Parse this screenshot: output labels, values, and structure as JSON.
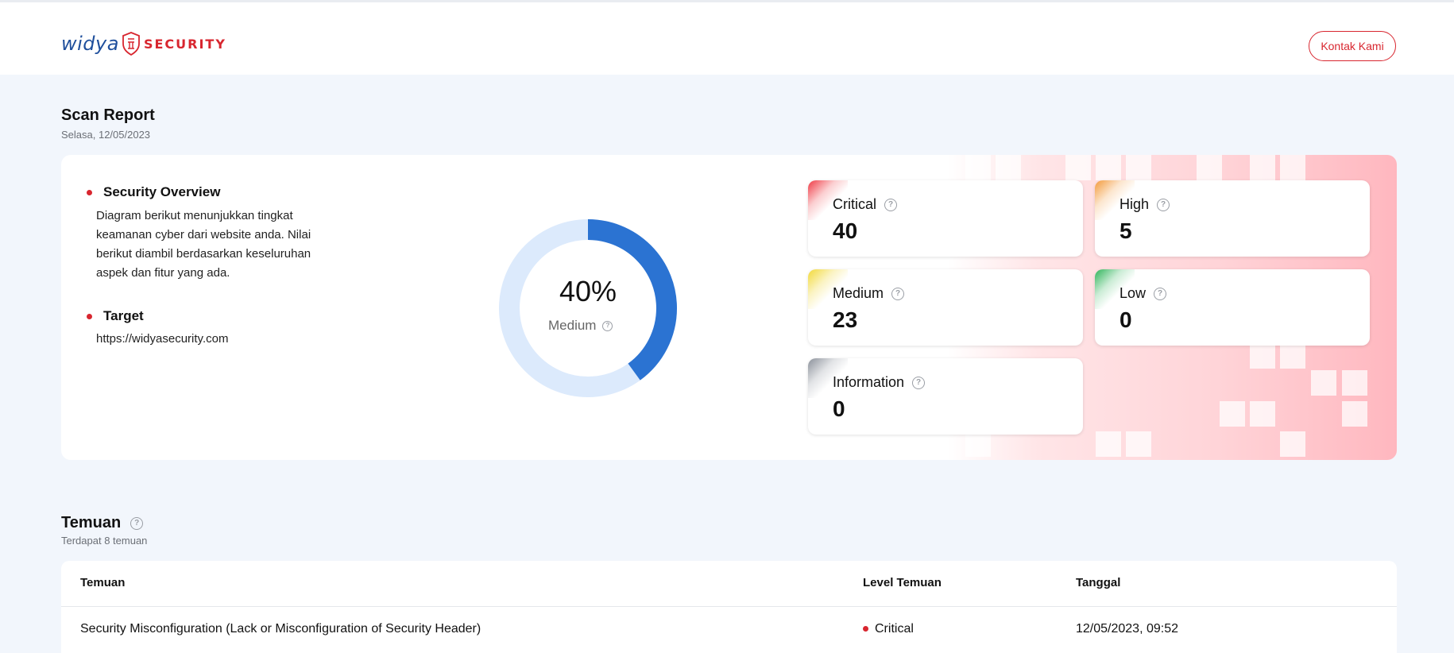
{
  "header": {
    "logo_word": "widya",
    "logo_sub": "SECURITY",
    "contact_label": "Kontak Kami"
  },
  "report": {
    "title": "Scan Report",
    "date": "Selasa, 12/05/2023",
    "overview_title": "Security Overview",
    "overview_desc": "Diagram berikut menunjukkan tingkat keamanan cyber dari website anda. Nilai berikut diambil berdasarkan keseluruhan aspek dan fitur yang ada.",
    "target_title": "Target",
    "target_url": "https://widyasecurity.com",
    "score": {
      "percent_label": "40%",
      "percent": 40,
      "level": "Medium"
    },
    "severity": [
      {
        "name": "Critical",
        "count": "40",
        "color": "#ef3b45"
      },
      {
        "name": "High",
        "count": "5",
        "color": "#f39a3b"
      },
      {
        "name": "Medium",
        "count": "23",
        "color": "#f2d93a"
      },
      {
        "name": "Low",
        "count": "0",
        "color": "#2fb45a"
      },
      {
        "name": "Information",
        "count": "0",
        "color": "#8a909a"
      }
    ]
  },
  "findings": {
    "title": "Temuan",
    "subtitle": "Terdapat 8 temuan",
    "columns": [
      "Temuan",
      "Level Temuan",
      "Tanggal"
    ],
    "rows": [
      {
        "name": "Security Misconfiguration (Lack or Misconfiguration of Security Header)",
        "level": "Critical",
        "date": "12/05/2023, 09:52"
      }
    ]
  },
  "colors": {
    "accent": "#d8262f",
    "brand_blue": "#1f4f9c",
    "donut": "#2b73d2",
    "donut_track": "#dceafc"
  }
}
